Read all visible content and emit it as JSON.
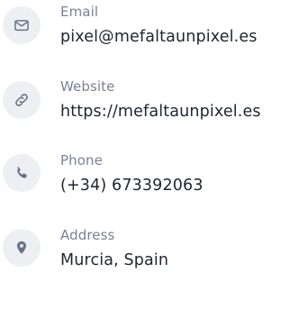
{
  "contacts": [
    {
      "icon": "mail-icon",
      "label": "Email",
      "value": "pixel@mefaltaunpixel.es"
    },
    {
      "icon": "link-icon",
      "label": "Website",
      "value": "https://mefaltaunpixel.es"
    },
    {
      "icon": "phone-icon",
      "label": "Phone",
      "value": "(+34) 673392063"
    },
    {
      "icon": "map-pin-icon",
      "label": "Address",
      "value": "Murcia, Spain"
    }
  ],
  "colors": {
    "icon_background": "#edeff3",
    "icon_color": "#68738a",
    "label": "#7a8292",
    "value": "#1f2530"
  }
}
